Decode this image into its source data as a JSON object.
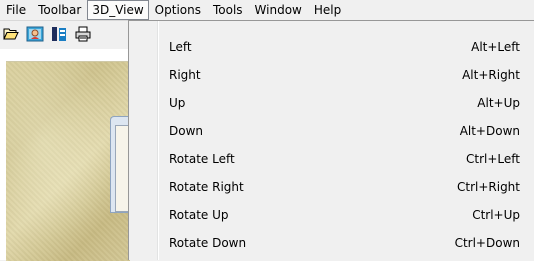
{
  "menubar": {
    "items": [
      "File",
      "Toolbar",
      "3D_View",
      "Options",
      "Tools",
      "Window",
      "Help"
    ],
    "active": "3D_View"
  },
  "toolbar": {
    "buttons": [
      "folder-open-icon",
      "image-view-icon",
      "layers-icon",
      "printer-icon"
    ]
  },
  "dropdown": {
    "items": [
      {
        "label": "Left",
        "shortcut": "Alt+Left"
      },
      {
        "label": "Right",
        "shortcut": "Alt+Right"
      },
      {
        "label": "Up",
        "shortcut": "Alt+Up"
      },
      {
        "label": "Down",
        "shortcut": "Alt+Down"
      },
      {
        "label": "Rotate Left",
        "shortcut": "Ctrl+Left"
      },
      {
        "label": "Rotate Right",
        "shortcut": "Ctrl+Right"
      },
      {
        "label": "Rotate Up",
        "shortcut": "Ctrl+Up"
      },
      {
        "label": "Rotate Down",
        "shortcut": "Ctrl+Down"
      }
    ]
  },
  "colors": {
    "menu_bg": "#f0f0f0",
    "menu_border": "#979797",
    "canvas_texture": "#d4c896"
  }
}
